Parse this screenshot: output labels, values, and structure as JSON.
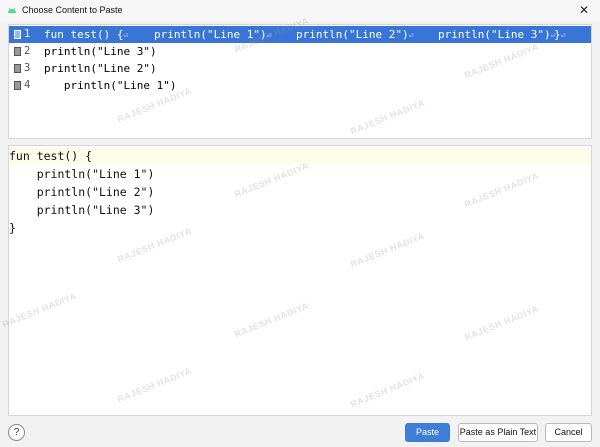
{
  "window": {
    "title": "Choose Content to Paste",
    "close_glyph": "✕"
  },
  "list": {
    "rows": [
      {
        "number": "1",
        "parts": [
          "fun test() {",
          "println(\"Line 1\")",
          "println(\"Line 2\")",
          "println(\"Line 3\")",
          "}"
        ],
        "selected": true
      },
      {
        "number": "2",
        "text": "println(\"Line 3\")",
        "selected": false
      },
      {
        "number": "3",
        "text": "println(\"Line 2\")",
        "selected": false
      },
      {
        "number": "4",
        "text": "   println(\"Line 1\")",
        "selected": false
      }
    ],
    "newline_glyph": "⏎"
  },
  "preview": {
    "lines": [
      "fun test() {",
      "    println(\"Line 1\")",
      "    println(\"Line 2\")",
      "    println(\"Line 3\")",
      "}"
    ]
  },
  "watermark": "RAJESH HADIYA",
  "footer": {
    "help_label": "?",
    "paste_label": "Paste",
    "paste_plain_label": "Paste as Plain Text",
    "cancel_label": "Cancel"
  },
  "colors": {
    "selection": "#3875d7",
    "primary_button": "#3d7fd6"
  }
}
